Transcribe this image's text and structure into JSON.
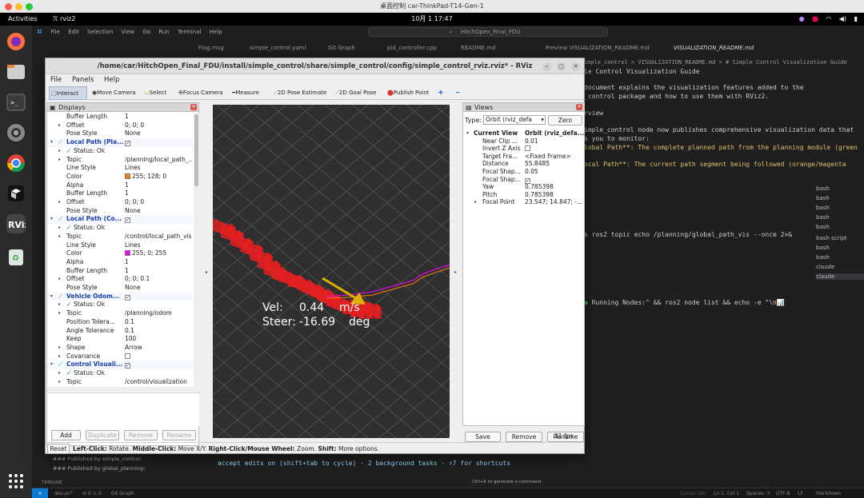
{
  "mac": {
    "title": "桌面控制 car-ThinkPad-T14-Gen-1"
  },
  "gnome": {
    "activities": "Activities",
    "app": "rviz2",
    "clock": "10月 1  17:47"
  },
  "vscode": {
    "menu": [
      "File",
      "Edit",
      "Selection",
      "View",
      "Go",
      "Run",
      "Terminal",
      "Help"
    ],
    "search": "HitchOpen_Final_FDU",
    "tabs": [
      "Flag.msg",
      "simple_control.yaml",
      "Git Graph",
      "pid_controller.cpp",
      "README.md",
      "Preview VISUALIZATION_README.md",
      "VISUALIZATION_README.md"
    ],
    "breadcrumb": "imple_control > VISUALIZATION_README.md > # Simple Control Visualization Guide",
    "doc_lines": [
      "le Control Visualization Guide",
      "document explains the visualization features added to the",
      "_control package and how to use them with RViz2.",
      "rview",
      "imple_control node now publishes comprehensive visualization data that",
      "s you to monitor:",
      "lobal Path**: The complete planned path from the planning module (green",
      "ocal Path**: The current path segment being followed (orange/magenta"
    ],
    "terminal_lines": [
      "s ros2 topic echo /planning/global_path_vis --once 2>&1 |",
      "Running Nodes:\" && ros2 node list && echo -e \"\\n📊"
    ],
    "claude_line": "accept edits on (shift+tab to cycle) · 2 background tasks · ↑7 for shortcuts",
    "claude_hint": "Ctrl+K to generate a command",
    "terminal_list": [
      "bash",
      "bash",
      "bash",
      "bash",
      "bash",
      "bash script",
      "bash",
      "bash",
      "claude",
      "claude"
    ],
    "outline": [
      "### Published by simple_control:",
      "### Published by global_planning:"
    ],
    "timeline": "TIMELINE",
    "status_left": [
      "dev-pc*",
      "⊘ 0 ⚠ 0",
      "Git Graph"
    ],
    "status_right": [
      "Ln 1, Col 1",
      "Spaces: 3",
      "UTF-8",
      "LF",
      "Markdown"
    ],
    "status_extra": "Cursor Tab"
  },
  "rviz": {
    "title": "/home/car/HitchOpen_Final_FDU/install/simple_control/share/simple_control/config/simple_control_rviz.rviz* - RViz",
    "menu": [
      "File",
      "Panels",
      "Help"
    ],
    "tools": [
      "Interact",
      "Move Camera",
      "Select",
      "Focus Camera",
      "Measure",
      "2D Pose Estimate",
      "2D Goal Pose",
      "Publish Point"
    ],
    "displays_title": "Displays",
    "display_rows": [
      {
        "k": "Buffer Length",
        "v": "1",
        "i": 2
      },
      {
        "k": "Offset",
        "v": "0; 0; 0",
        "i": 2,
        "a": "▸"
      },
      {
        "k": "Pose Style",
        "v": "None",
        "i": 2
      },
      {
        "k": "Local Path (Pla...",
        "v": "",
        "i": 1,
        "g": true,
        "a": "▾",
        "cb": "✓"
      },
      {
        "k": "Status: Ok",
        "v": "",
        "i": 2,
        "a": "▸",
        "ok": true
      },
      {
        "k": "Topic",
        "v": "/planning/local_path_...",
        "i": 2,
        "a": "▸"
      },
      {
        "k": "Line Style",
        "v": "Lines",
        "i": 2
      },
      {
        "k": "Color",
        "v": "255; 128; 0",
        "i": 2,
        "c": "#ff8000"
      },
      {
        "k": "Alpha",
        "v": "1",
        "i": 2
      },
      {
        "k": "Buffer Length",
        "v": "1",
        "i": 2
      },
      {
        "k": "Offset",
        "v": "0; 0; 0",
        "i": 2,
        "a": "▸"
      },
      {
        "k": "Pose Style",
        "v": "None",
        "i": 2
      },
      {
        "k": "Local Path (Co...",
        "v": "",
        "i": 1,
        "g": true,
        "a": "▾",
        "cb": "✓"
      },
      {
        "k": "Status: Ok",
        "v": "",
        "i": 2,
        "a": "▸",
        "ok": true
      },
      {
        "k": "Topic",
        "v": "/control/local_path_vis",
        "i": 2,
        "a": "▸"
      },
      {
        "k": "Line Style",
        "v": "Lines",
        "i": 2
      },
      {
        "k": "Color",
        "v": "255; 0; 255",
        "i": 2,
        "c": "#ff00ff"
      },
      {
        "k": "Alpha",
        "v": "1",
        "i": 2
      },
      {
        "k": "Buffer Length",
        "v": "1",
        "i": 2
      },
      {
        "k": "Offset",
        "v": "0; 0; 0.1",
        "i": 2,
        "a": "▸"
      },
      {
        "k": "Pose Style",
        "v": "None",
        "i": 2
      },
      {
        "k": "Vehicle Odom...",
        "v": "",
        "i": 1,
        "g": true,
        "a": "▾",
        "cb": "✓"
      },
      {
        "k": "Status: Ok",
        "v": "",
        "i": 2,
        "a": "▸",
        "ok": true
      },
      {
        "k": "Topic",
        "v": "/planning/odom",
        "i": 2,
        "a": "▸"
      },
      {
        "k": "Position Tolera...",
        "v": "0.1",
        "i": 2
      },
      {
        "k": "Angle Tolerance",
        "v": "0.1",
        "i": 2
      },
      {
        "k": "Keep",
        "v": "100",
        "i": 2
      },
      {
        "k": "Shape",
        "v": "Arrow",
        "i": 2,
        "a": "▸"
      },
      {
        "k": "Covariance",
        "v": "",
        "i": 2,
        "a": "▸",
        "cb": ""
      },
      {
        "k": "Control Visuali...",
        "v": "",
        "i": 1,
        "g": true,
        "a": "▾",
        "cb": "✓"
      },
      {
        "k": "Status: Ok",
        "v": "",
        "i": 2,
        "a": "▸",
        "ok": true
      },
      {
        "k": "Topic",
        "v": "/control/visualization",
        "i": 2,
        "a": "▸"
      }
    ],
    "display_buttons": [
      "Add",
      "Duplicate",
      "Remove",
      "Rename"
    ],
    "hud": {
      "vel_label": "Vel:",
      "vel_value": "0.44",
      "vel_unit": "m/s",
      "steer_label": "Steer:",
      "steer_value": "-16.69",
      "steer_unit": "deg"
    },
    "views_title": "Views",
    "views_type_label": "Type:",
    "views_type_value": "Orbit (rviz_defa",
    "views_zero": "Zero",
    "views_rows": [
      {
        "k": "Current View",
        "v": "Orbit (rviz_defa...",
        "b": true,
        "a": "▾"
      },
      {
        "k": "Near Clip ...",
        "v": "0.01"
      },
      {
        "k": "Invert Z Axis",
        "v": "",
        "cb": ""
      },
      {
        "k": "Target Fra...",
        "v": "<Fixed Frame>"
      },
      {
        "k": "Distance",
        "v": "55.8485"
      },
      {
        "k": "Focal Shap...",
        "v": "0.05"
      },
      {
        "k": "Focal Shap...",
        "v": "",
        "cb": "✓"
      },
      {
        "k": "Yaw",
        "v": "0.785398"
      },
      {
        "k": "Pitch",
        "v": "0.785398"
      },
      {
        "k": "Focal Point",
        "v": "23.547; 14.847; -...",
        "a": "▸"
      }
    ],
    "views_buttons": [
      "Save",
      "Remove",
      "Rename"
    ],
    "fps": "31 fps",
    "reset": "Reset",
    "hint_b1": "Left-Click:",
    "hint_t1": " Rotate. ",
    "hint_b2": "Middle-Click:",
    "hint_t2": " Move X/Y. ",
    "hint_b3": "Right-Click/Mouse Wheel:",
    "hint_t3": " Zoom. ",
    "hint_b4": "Shift:",
    "hint_t4": " More options."
  },
  "colors": {
    "local_path_planning": "#ff8000",
    "local_path_control": "#ff00ff",
    "odom_arrows": "#e02020",
    "vehicle_arrow": "#e0b000"
  }
}
